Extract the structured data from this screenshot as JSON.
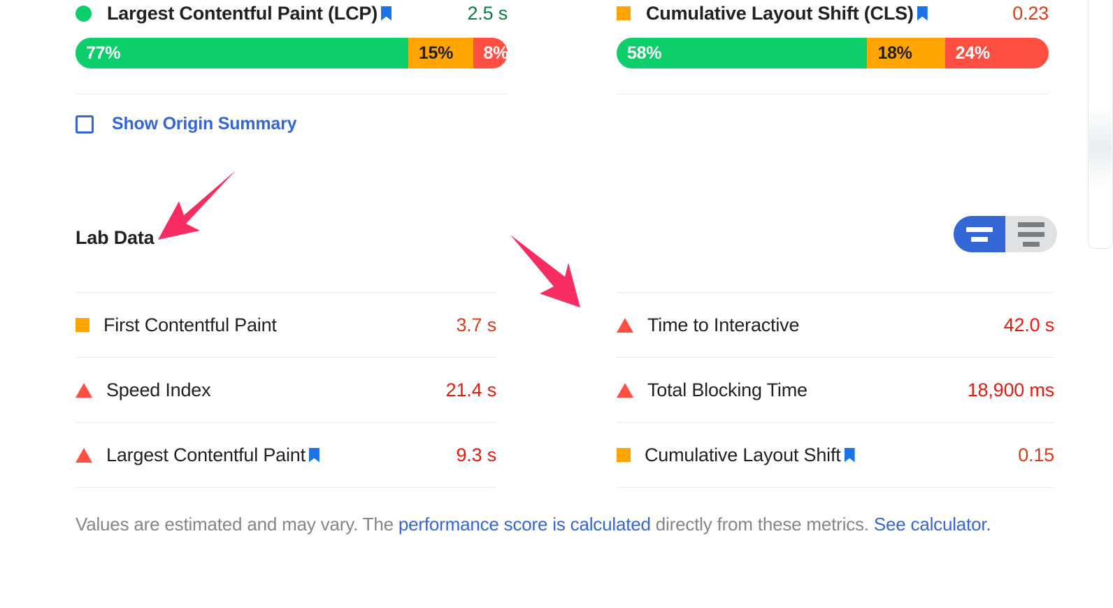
{
  "field_data": {
    "metrics": [
      {
        "shape": "circle",
        "shape_color": "#0CCE6B",
        "name": "Largest Contentful Paint (LCP)",
        "has_bookmark": true,
        "value": "2.5 s",
        "value_color": "#0a7c43",
        "distribution": [
          {
            "label": "77%",
            "pct": 77,
            "band": "good"
          },
          {
            "label": "15%",
            "pct": 15,
            "band": "average"
          },
          {
            "label": "8%",
            "pct": 8,
            "band": "poor"
          }
        ]
      },
      {
        "shape": "square",
        "shape_color": "#FFA400",
        "name": "Cumulative Layout Shift (CLS)",
        "has_bookmark": true,
        "value": "0.23",
        "value_color": "#d93c16",
        "distribution": [
          {
            "label": "58%",
            "pct": 58,
            "band": "good"
          },
          {
            "label": "18%",
            "pct": 18,
            "band": "average"
          },
          {
            "label": "24%",
            "pct": 24,
            "band": "poor"
          }
        ]
      }
    ],
    "origin_summary": {
      "label": "Show Origin Summary",
      "checked": false
    }
  },
  "lab_data": {
    "title": "Lab Data",
    "view_toggle": {
      "options": [
        "expanded-view",
        "compact-view"
      ],
      "selected": "expanded-view",
      "accent": "#3367D6"
    },
    "left_column": [
      {
        "shape": "square",
        "shape_color": "#FFA400",
        "name": "First Contentful Paint",
        "has_bookmark": false,
        "value": "3.7 s",
        "value_color": "#d93c16"
      },
      {
        "shape": "triangle",
        "shape_color": "#FF4E42",
        "name": "Speed Index",
        "has_bookmark": false,
        "value": "21.4 s",
        "value_color": "#e81a0c"
      },
      {
        "shape": "triangle",
        "shape_color": "#FF4E42",
        "name": "Largest Contentful Paint",
        "has_bookmark": true,
        "value": "9.3 s",
        "value_color": "#e81a0c"
      }
    ],
    "right_column": [
      {
        "shape": "triangle",
        "shape_color": "#FF4E42",
        "name": "Time to Interactive",
        "has_bookmark": false,
        "value": "42.0 s",
        "value_color": "#e81a0c"
      },
      {
        "shape": "triangle",
        "shape_color": "#FF4E42",
        "name": "Total Blocking Time",
        "has_bookmark": false,
        "value": "18,900 ms",
        "value_color": "#e81a0c"
      },
      {
        "shape": "square",
        "shape_color": "#FFA400",
        "name": "Cumulative Layout Shift",
        "has_bookmark": true,
        "value": "0.15",
        "value_color": "#d93c16"
      }
    ],
    "footer": {
      "part1": "Values are estimated and may vary. The ",
      "link1": "performance score is calculated",
      "part2": " directly from these metrics. ",
      "link2": "See calculator."
    }
  },
  "annotations": {
    "arrow_color": "#F72C60",
    "arrows": [
      {
        "name": "arrow-pointing-to-lab-data",
        "direction": "down-left"
      },
      {
        "name": "arrow-pointing-to-time-to-interactive",
        "direction": "down-right"
      }
    ]
  }
}
